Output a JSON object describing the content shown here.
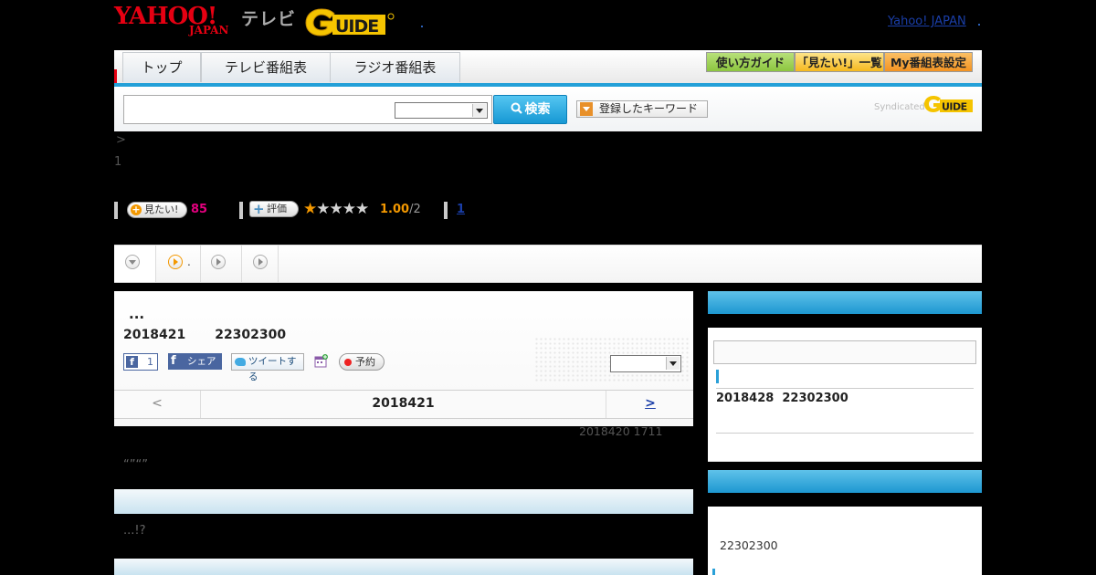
{
  "header": {
    "yahoo_logo": "YAHOO!",
    "yahoo_japan": "JAPAN",
    "tv_label": "テレビ",
    "gguide_logo": "G-GUIDE",
    "yahoo_japan_link": "Yahoo! JAPAN"
  },
  "nav": {
    "tabs": [
      "トップ",
      "テレビ番組表",
      "ラジオ番組表"
    ],
    "guide_buttons": [
      {
        "label": "使い方ガイド",
        "color": "#8cc63f"
      },
      {
        "label": "「見たい!」一覧",
        "color": "#f5b81f"
      },
      {
        "label": "My番組表設定",
        "color": "#f39322"
      }
    ]
  },
  "search": {
    "input_value": "",
    "select_value": "",
    "button_label": "検索",
    "keyword_button": "登録したキーワード",
    "syndicated": "Syndicated"
  },
  "breadcrumb": ">",
  "episode_num": "1",
  "ratings": {
    "mitai_label": "見たい!",
    "mitai_count": "85",
    "hyouka_label": "評価",
    "stars_filled": 1,
    "stars_total": 5,
    "score": "1.00",
    "score_den": "/2",
    "review_link": "1"
  },
  "subtabs": {
    "tab2_text": "."
  },
  "program": {
    "title": "...",
    "date": "2018421",
    "time": "22302300",
    "fb_count": "1",
    "share_label": "シェア",
    "tweet_label": "ツイートする",
    "reserve_label": "予約",
    "select_value": ""
  },
  "date_nav": {
    "prev": "<",
    "current": "2018421",
    "next": ">"
  },
  "updated": "2018420  1711",
  "quotes": "“”“”",
  "excerpt": "...!?",
  "sidebar": {
    "next_air_date": "2018428",
    "next_air_time": "22302300",
    "second_time": "22302300"
  },
  "colors": {
    "accent_blue": "#1d97d1",
    "nav_underline": "#23a0d8",
    "mitai_pink": "#e4007f",
    "star_orange": "#f39800",
    "link_blue": "#1a3ea8"
  }
}
